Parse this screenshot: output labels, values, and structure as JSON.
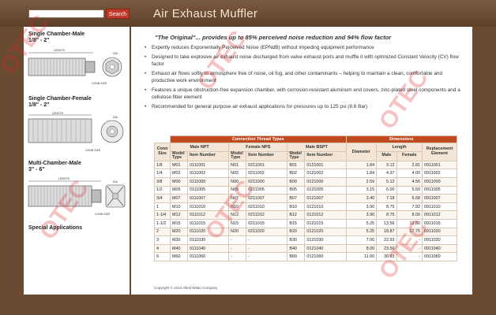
{
  "header": {
    "search_button": "Search",
    "title": "Air Exhaust Muffler"
  },
  "sidebar": {
    "sections": [
      {
        "title_line1": "Single Chamber-Male",
        "title_line2": "1/8\" - 2\"",
        "length_label": "LENGTH",
        "dia_label": "DIA.",
        "conn_label": "CONN SIZE"
      },
      {
        "title_line1": "Single Chamber-Female",
        "title_line2": "1/8\" - 2\"",
        "length_label": "LENGTH",
        "dia_label": "DIA.",
        "conn_label": "CONN SIZE"
      },
      {
        "title_line1": "Multi-Chamber-Male",
        "title_line2": "3\" - 6\"",
        "length_label": "LENGTH",
        "dia_label": "DIA.",
        "conn_label": "CONN SIZE"
      }
    ],
    "special": "Special Applications"
  },
  "main": {
    "tagline": "\"The Original\"... provides up to 85% perceived noise reduction and 94% flow factor",
    "bullets": [
      "Expertly reduces Exponentially Perceived Noise (EPNdB) without impeding equipment performance",
      "Designed to take explosive air exhaust noise discharged from valve exhaust ports and muffle it with optimized Constant Velocity (CV) flow factor",
      "Exhaust air flows softly to atmosphere free of noise, oil fog, and other contaminants – helping to maintain a clean, comfortable and productive work environment",
      "Features a unique obstruction-free expansion chamber, with corrosion-resistant aluminum end covers, zinc-plated steel components and a cellulose fiber element",
      "Recommended for general purpose air exhaust applications for pressures up to 125 psi (8.6 Bar)"
    ],
    "copyright": "Copyright © 2010 Allied Witan Company"
  },
  "table": {
    "band_conn": "Connection Thread Types",
    "band_dim": "Dimensions",
    "col_conn_size": "Conn Size",
    "col_male_npt": "Male NPT",
    "col_female_nps": "Female NPS",
    "col_male_bspt": "Male BSPT",
    "col_diameter": "Diameter",
    "col_length": "Length",
    "col_replacement": "Replacement Element",
    "sub_model_type": "Model Type",
    "sub_item_number": "Item Number",
    "sub_male": "Male",
    "sub_female": "Female",
    "rows": [
      [
        "1/8",
        "M01",
        "0111001",
        "N01",
        "0211001",
        "B01",
        "0121001",
        "1.84",
        "3.12",
        "2.81",
        "0911001"
      ],
      [
        "1/4",
        "M02",
        "0111002",
        "N02",
        "0211002",
        "B02",
        "0121002",
        "1.84",
        "4.37",
        "4.00",
        "0911002"
      ],
      [
        "3/8",
        "M00",
        "0111000",
        "N00",
        "0211000",
        "B00",
        "0121000",
        "2.59",
        "5.12",
        "4.56",
        "0911000"
      ],
      [
        "1/2",
        "M05",
        "0111005",
        "N05",
        "0211005",
        "B05",
        "0121005",
        "3.15",
        "6.00",
        "5.50",
        "0911005"
      ],
      [
        "3/4",
        "M07",
        "0111007",
        "N07",
        "0211007",
        "B07",
        "0121007",
        "3.40",
        "7.18",
        "6.68",
        "0911007"
      ],
      [
        "1",
        "M10",
        "0111010",
        "N10",
        "0211010",
        "B10",
        "0121010",
        "3.90",
        "8.75",
        "7.92",
        "0911010"
      ],
      [
        "1-1/4",
        "M12",
        "0111012",
        "N12",
        "0211012",
        "B12",
        "0121012",
        "3.90",
        "8.75",
        "8.00",
        "0911012"
      ],
      [
        "1-1/2",
        "M15",
        "0111015",
        "N15",
        "0211015",
        "B15",
        "0121015",
        "5.25",
        "13.56",
        "12.50",
        "0911015"
      ],
      [
        "2",
        "M20",
        "0111020",
        "N20",
        "0211020",
        "B20",
        "0121020",
        "5.25",
        "18.87",
        "17.75",
        "0911020"
      ],
      [
        "3",
        "M30",
        "0111030",
        "-",
        "-",
        "B30",
        "0121030",
        "7.00",
        "22.93",
        "-",
        "0911030"
      ],
      [
        "4",
        "M40",
        "0111040",
        "-",
        "-",
        "B40",
        "0121040",
        "8.00",
        "23.56",
        "-",
        "0911040"
      ],
      [
        "6",
        "M60",
        "0111060",
        "-",
        "-",
        "B60",
        "0121060",
        "11.00",
        "30.93",
        "-",
        "0911060"
      ]
    ]
  },
  "watermark_text": "OTEC",
  "colors": {
    "brand_brown": "#6b4a32",
    "table_header": "#c0491f",
    "search_button": "#c0392b",
    "watermark": "#dc2828"
  }
}
